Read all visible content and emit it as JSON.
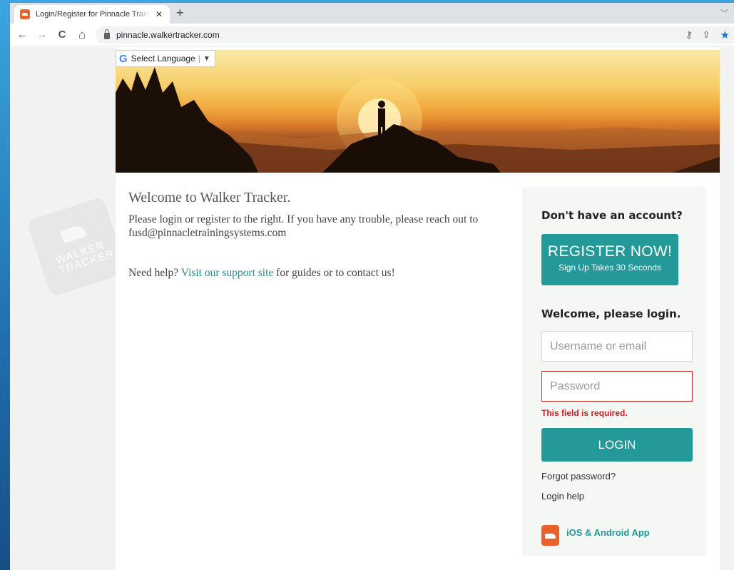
{
  "browser": {
    "tab_title": "Login/Register for Pinnacle Training Systems",
    "tab_close": "✕",
    "new_tab": "+",
    "url": "pinnacle.walkertracker.com",
    "nav": {
      "back": "←",
      "forward": "→",
      "reload": "C",
      "home": "⌂"
    },
    "omni_icons": {
      "key": "⚷",
      "share": "⇪",
      "star": "★"
    }
  },
  "translate": {
    "g": "G",
    "label": "Select Language",
    "sep": "|",
    "arrow": "▼"
  },
  "watermark": {
    "line1": "WALKER",
    "line2": "TRACKER"
  },
  "main": {
    "title": "Welcome to Walker Tracker.",
    "intro": "Please login or register to the right. If you have any trouble, please reach out to fusd@pinnacletrainingsystems.com",
    "help_prefix": "Need help?",
    "help_link": "Visit our support site",
    "help_suffix": "for guides or to contact us!"
  },
  "panel": {
    "no_account": "Don't have an account?",
    "register_main": "REGISTER NOW!",
    "register_sub": "Sign Up Takes 30 Seconds",
    "login_heading": "Welcome, please login.",
    "username_placeholder": "Username or email",
    "password_placeholder": "Password",
    "error": "This field is required.",
    "login_button": "LOGIN",
    "forgot": "Forgot password?",
    "login_help": "Login help",
    "app_label": "iOS & Android App"
  },
  "colors": {
    "teal": "#23999a",
    "error": "#c92020",
    "brand_orange": "#e8622c"
  }
}
